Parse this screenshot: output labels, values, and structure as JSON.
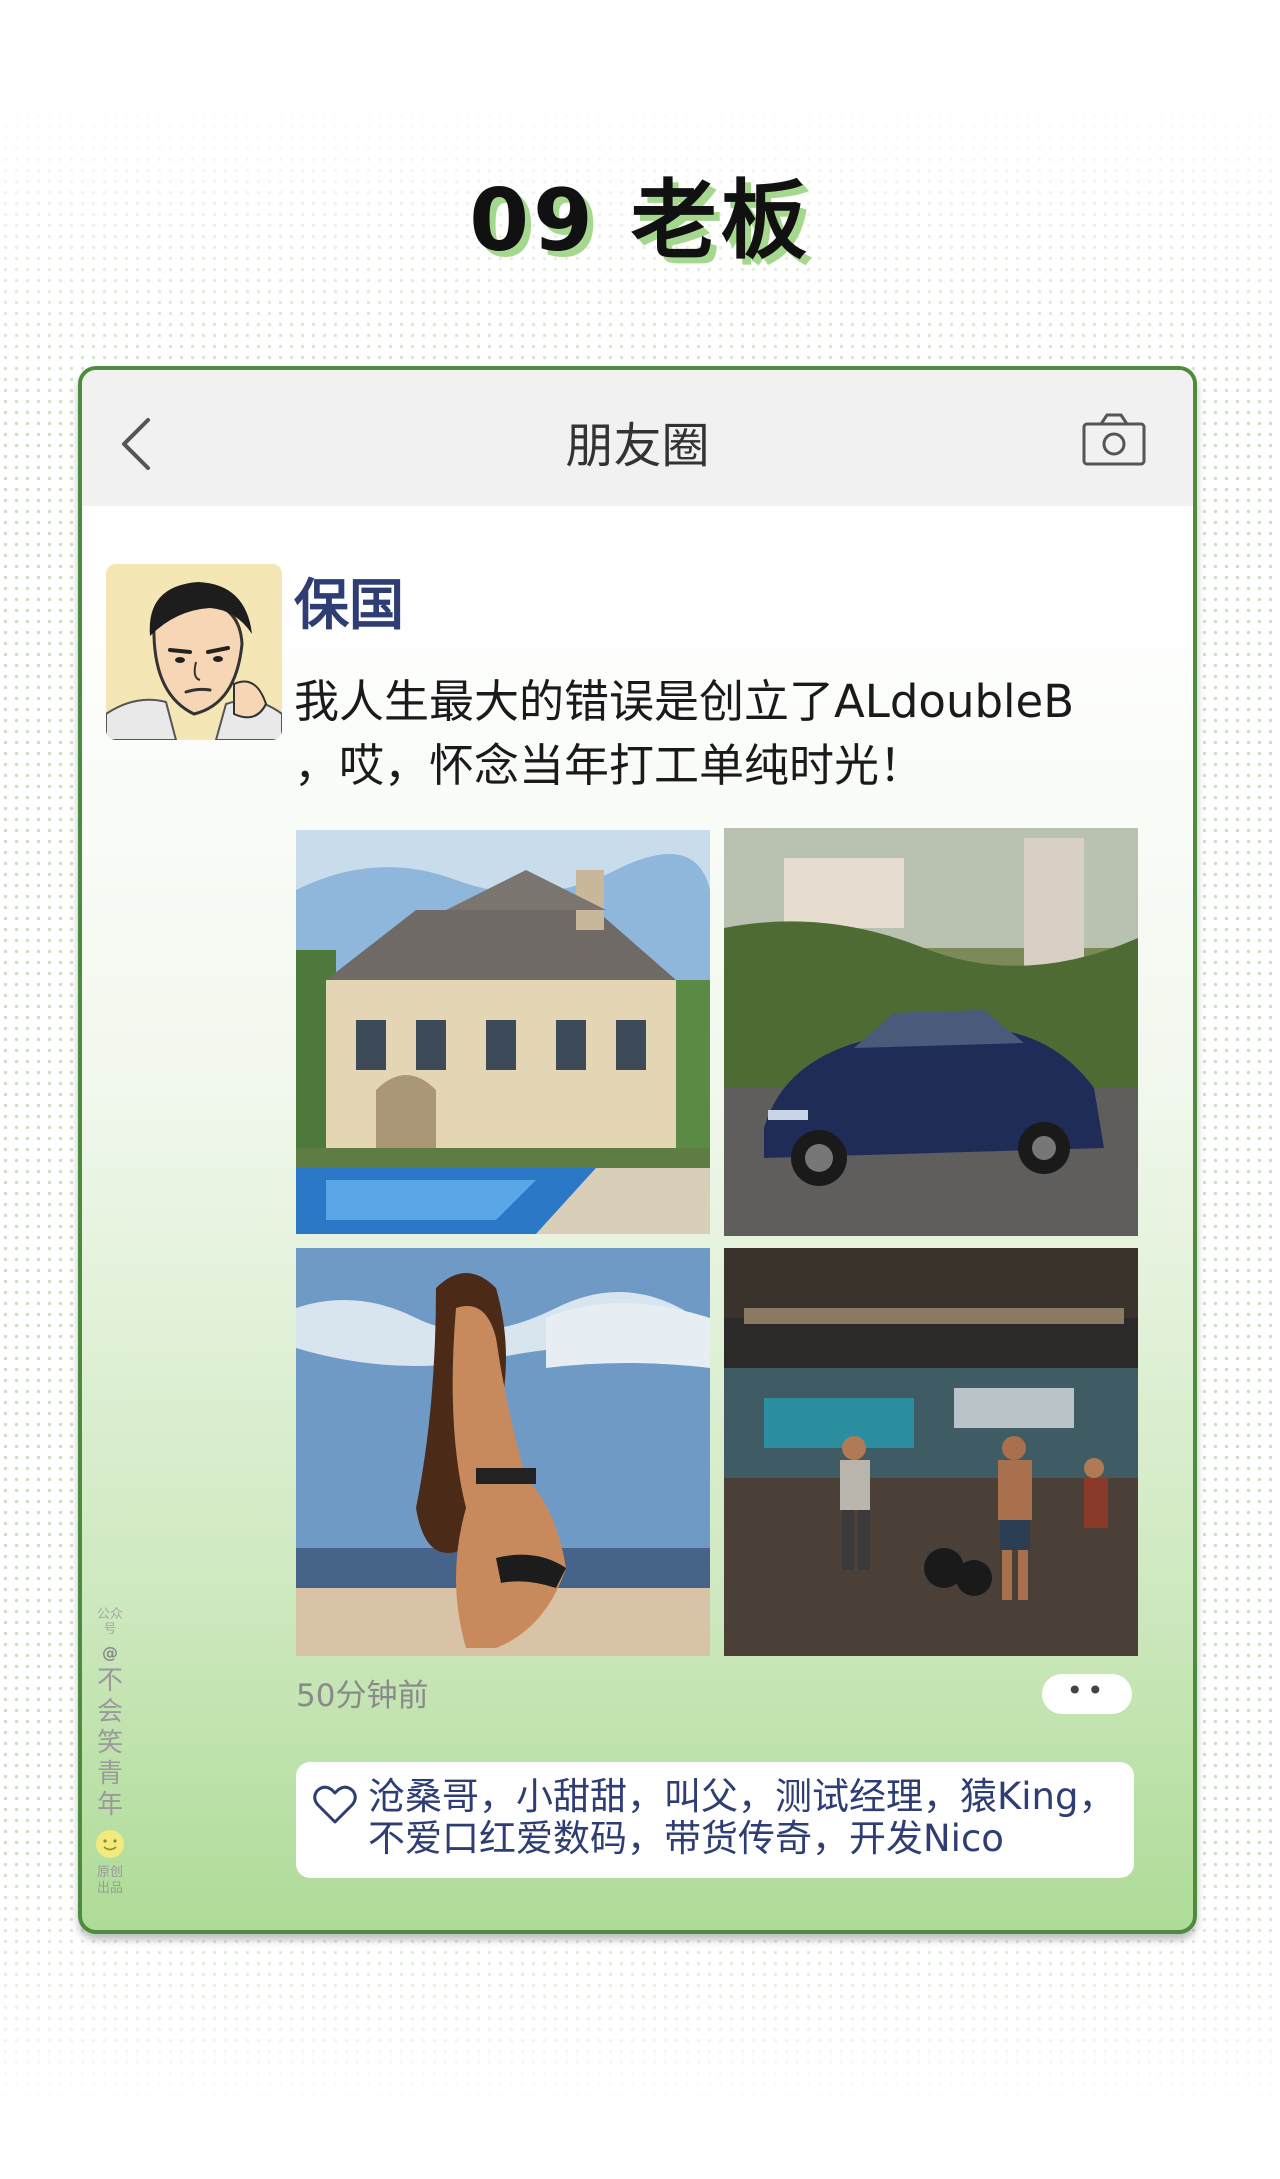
{
  "page": {
    "title": "09 老板"
  },
  "navbar": {
    "back_icon": "chevron-left-icon",
    "title": "朋友圈",
    "camera_icon": "camera-icon"
  },
  "post": {
    "username": "保国",
    "text_line1": "我人生最大的错误是创立了ALdoubleB",
    "text_line2": "，哎，怀念当年打工单纯时光！",
    "photos": [
      "mansion-with-pool-photo",
      "blue-sports-car-photo",
      "woman-on-beach-photo",
      "crossfit-gym-photo"
    ],
    "time": "50分钟前",
    "more_button": "••",
    "likes_line1": "沧桑哥，小甜甜，叫父，测试经理，猿King，",
    "likes_line2": "不爱口红爱数码，带货传奇，开发Nico"
  },
  "watermark": {
    "top": "公众号",
    "at": "@",
    "name": "不会笑青年",
    "bottom": "原创出品"
  },
  "colors": {
    "accent_green": "#4f8b3c",
    "title_shadow": "#a5d88f",
    "username": "#2e3e74",
    "navbar_bg": "#f1f1f1"
  }
}
